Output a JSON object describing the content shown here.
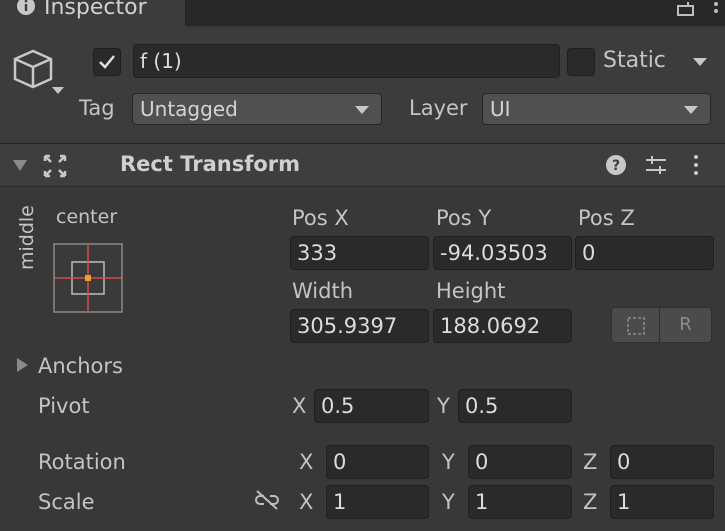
{
  "tab": {
    "title": "Inspector"
  },
  "object": {
    "name": "f (1)",
    "static_label": "Static"
  },
  "tag": {
    "label": "Tag",
    "value": "Untagged"
  },
  "layer": {
    "label": "Layer",
    "value": "UI"
  },
  "rect_transform": {
    "title": "Rect Transform",
    "anchor_preset": {
      "horizontal": "center",
      "vertical": "middle"
    },
    "pos_x": {
      "label": "Pos X",
      "value": "333"
    },
    "pos_y": {
      "label": "Pos Y",
      "value": "-94.03503"
    },
    "pos_z": {
      "label": "Pos Z",
      "value": "0"
    },
    "width": {
      "label": "Width",
      "value": "305.9397"
    },
    "height": {
      "label": "Height",
      "value": "188.0692"
    },
    "raw_button": "R",
    "anchors_label": "Anchors",
    "pivot": {
      "label": "Pivot",
      "x_label": "X",
      "x": "0.5",
      "y_label": "Y",
      "y": "0.5"
    },
    "rotation": {
      "label": "Rotation",
      "x_label": "X",
      "x": "0",
      "y_label": "Y",
      "y": "0",
      "z_label": "Z",
      "z": "0"
    },
    "scale": {
      "label": "Scale",
      "x_label": "X",
      "x": "1",
      "y_label": "Y",
      "y": "1",
      "z_label": "Z",
      "z": "1"
    }
  },
  "icons": {
    "tab": "info-icon",
    "object": "cube-icon",
    "section": "rect-transform-icon",
    "help": "help-icon",
    "presets": "sliders-icon",
    "menu": "kebab-icon",
    "scale_link": "unlink-icon"
  }
}
